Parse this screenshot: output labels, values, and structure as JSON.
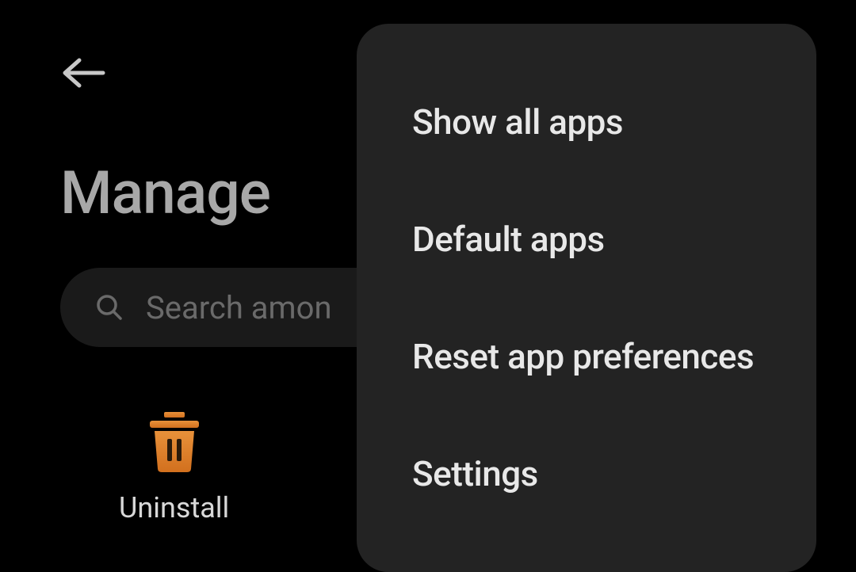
{
  "header": {
    "title": "Manage"
  },
  "search": {
    "placeholder": "Search amon"
  },
  "actions": {
    "uninstall_label": "Uninstall"
  },
  "menu": {
    "items": [
      "Show all apps",
      "Default apps",
      "Reset app preferences",
      "Settings"
    ]
  }
}
